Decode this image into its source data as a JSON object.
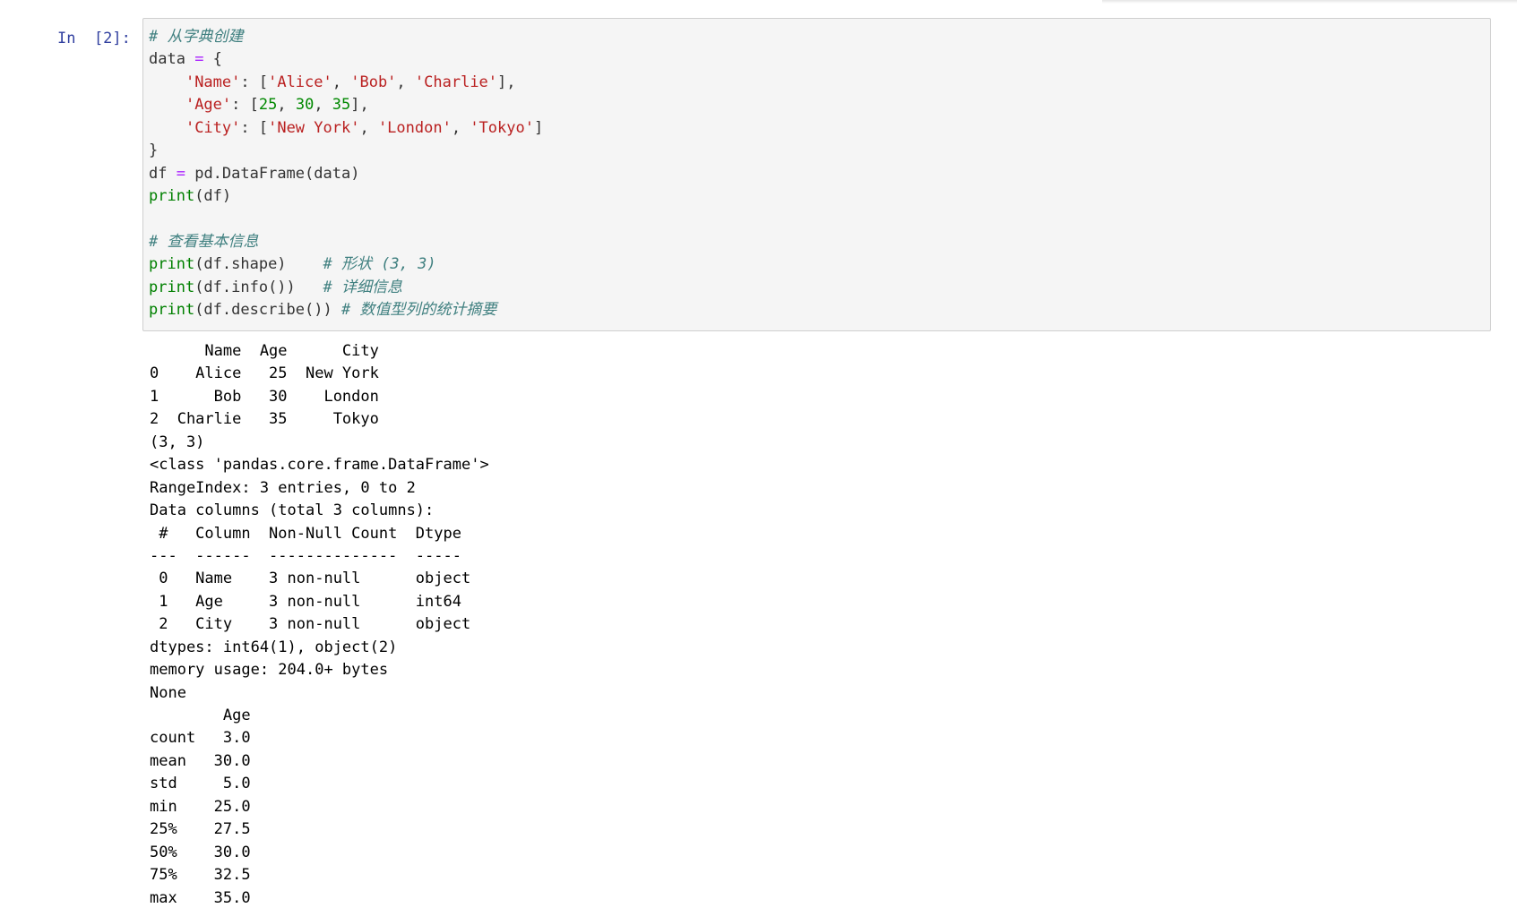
{
  "prompt": "In  [2]:",
  "code_lines": [
    [
      {
        "t": "# 从字典创建",
        "c": "comment"
      }
    ],
    [
      {
        "t": "data ",
        "c": "plain"
      },
      {
        "t": "=",
        "c": "op"
      },
      {
        "t": " {",
        "c": "plain"
      }
    ],
    [
      {
        "t": "    ",
        "c": "plain"
      },
      {
        "t": "'Name'",
        "c": "string"
      },
      {
        "t": ": [",
        "c": "plain"
      },
      {
        "t": "'Alice'",
        "c": "string"
      },
      {
        "t": ", ",
        "c": "plain"
      },
      {
        "t": "'Bob'",
        "c": "string"
      },
      {
        "t": ", ",
        "c": "plain"
      },
      {
        "t": "'Charlie'",
        "c": "string"
      },
      {
        "t": "],",
        "c": "plain"
      }
    ],
    [
      {
        "t": "    ",
        "c": "plain"
      },
      {
        "t": "'Age'",
        "c": "string"
      },
      {
        "t": ": [",
        "c": "plain"
      },
      {
        "t": "25",
        "c": "number"
      },
      {
        "t": ", ",
        "c": "plain"
      },
      {
        "t": "30",
        "c": "number"
      },
      {
        "t": ", ",
        "c": "plain"
      },
      {
        "t": "35",
        "c": "number"
      },
      {
        "t": "],",
        "c": "plain"
      }
    ],
    [
      {
        "t": "    ",
        "c": "plain"
      },
      {
        "t": "'City'",
        "c": "string"
      },
      {
        "t": ": [",
        "c": "plain"
      },
      {
        "t": "'New York'",
        "c": "string"
      },
      {
        "t": ", ",
        "c": "plain"
      },
      {
        "t": "'London'",
        "c": "string"
      },
      {
        "t": ", ",
        "c": "plain"
      },
      {
        "t": "'Tokyo'",
        "c": "string"
      },
      {
        "t": "]",
        "c": "plain"
      }
    ],
    [
      {
        "t": "}",
        "c": "plain"
      }
    ],
    [
      {
        "t": "df ",
        "c": "plain"
      },
      {
        "t": "=",
        "c": "op"
      },
      {
        "t": " pd.DataFrame(data)",
        "c": "plain"
      }
    ],
    [
      {
        "t": "print",
        "c": "builtin"
      },
      {
        "t": "(df)",
        "c": "plain"
      }
    ],
    [
      {
        "t": "",
        "c": "plain"
      }
    ],
    [
      {
        "t": "# 查看基本信息",
        "c": "comment"
      }
    ],
    [
      {
        "t": "print",
        "c": "builtin"
      },
      {
        "t": "(df.shape)    ",
        "c": "plain"
      },
      {
        "t": "# 形状 (3, 3)",
        "c": "comment"
      }
    ],
    [
      {
        "t": "print",
        "c": "builtin"
      },
      {
        "t": "(df.info())   ",
        "c": "plain"
      },
      {
        "t": "# 详细信息",
        "c": "comment"
      }
    ],
    [
      {
        "t": "print",
        "c": "builtin"
      },
      {
        "t": "(df.describe()) ",
        "c": "plain"
      },
      {
        "t": "# 数值型列的统计摘要",
        "c": "comment"
      }
    ]
  ],
  "output_lines": [
    "      Name  Age      City",
    "0    Alice   25  New York",
    "1      Bob   30    London",
    "2  Charlie   35     Tokyo",
    "(3, 3)",
    "<class 'pandas.core.frame.DataFrame'>",
    "RangeIndex: 3 entries, 0 to 2",
    "Data columns (total 3 columns):",
    " #   Column  Non-Null Count  Dtype ",
    "---  ------  --------------  ----- ",
    " 0   Name    3 non-null      object",
    " 1   Age     3 non-null      int64 ",
    " 2   City    3 non-null      object",
    "dtypes: int64(1), object(2)",
    "memory usage: 204.0+ bytes",
    "None",
    "        Age",
    "count   3.0",
    "mean   30.0",
    "std     5.0",
    "min    25.0",
    "25%    27.5",
    "50%    30.0",
    "75%    32.5",
    "max    35.0"
  ],
  "colors": {
    "comment": "#408080",
    "string": "#ba2121",
    "number": "#008800",
    "operator": "#aa22ff",
    "builtin": "#008000",
    "prompt": "#303f9f",
    "input_background": "#f5f5f5",
    "input_border": "#cfcfcf"
  }
}
